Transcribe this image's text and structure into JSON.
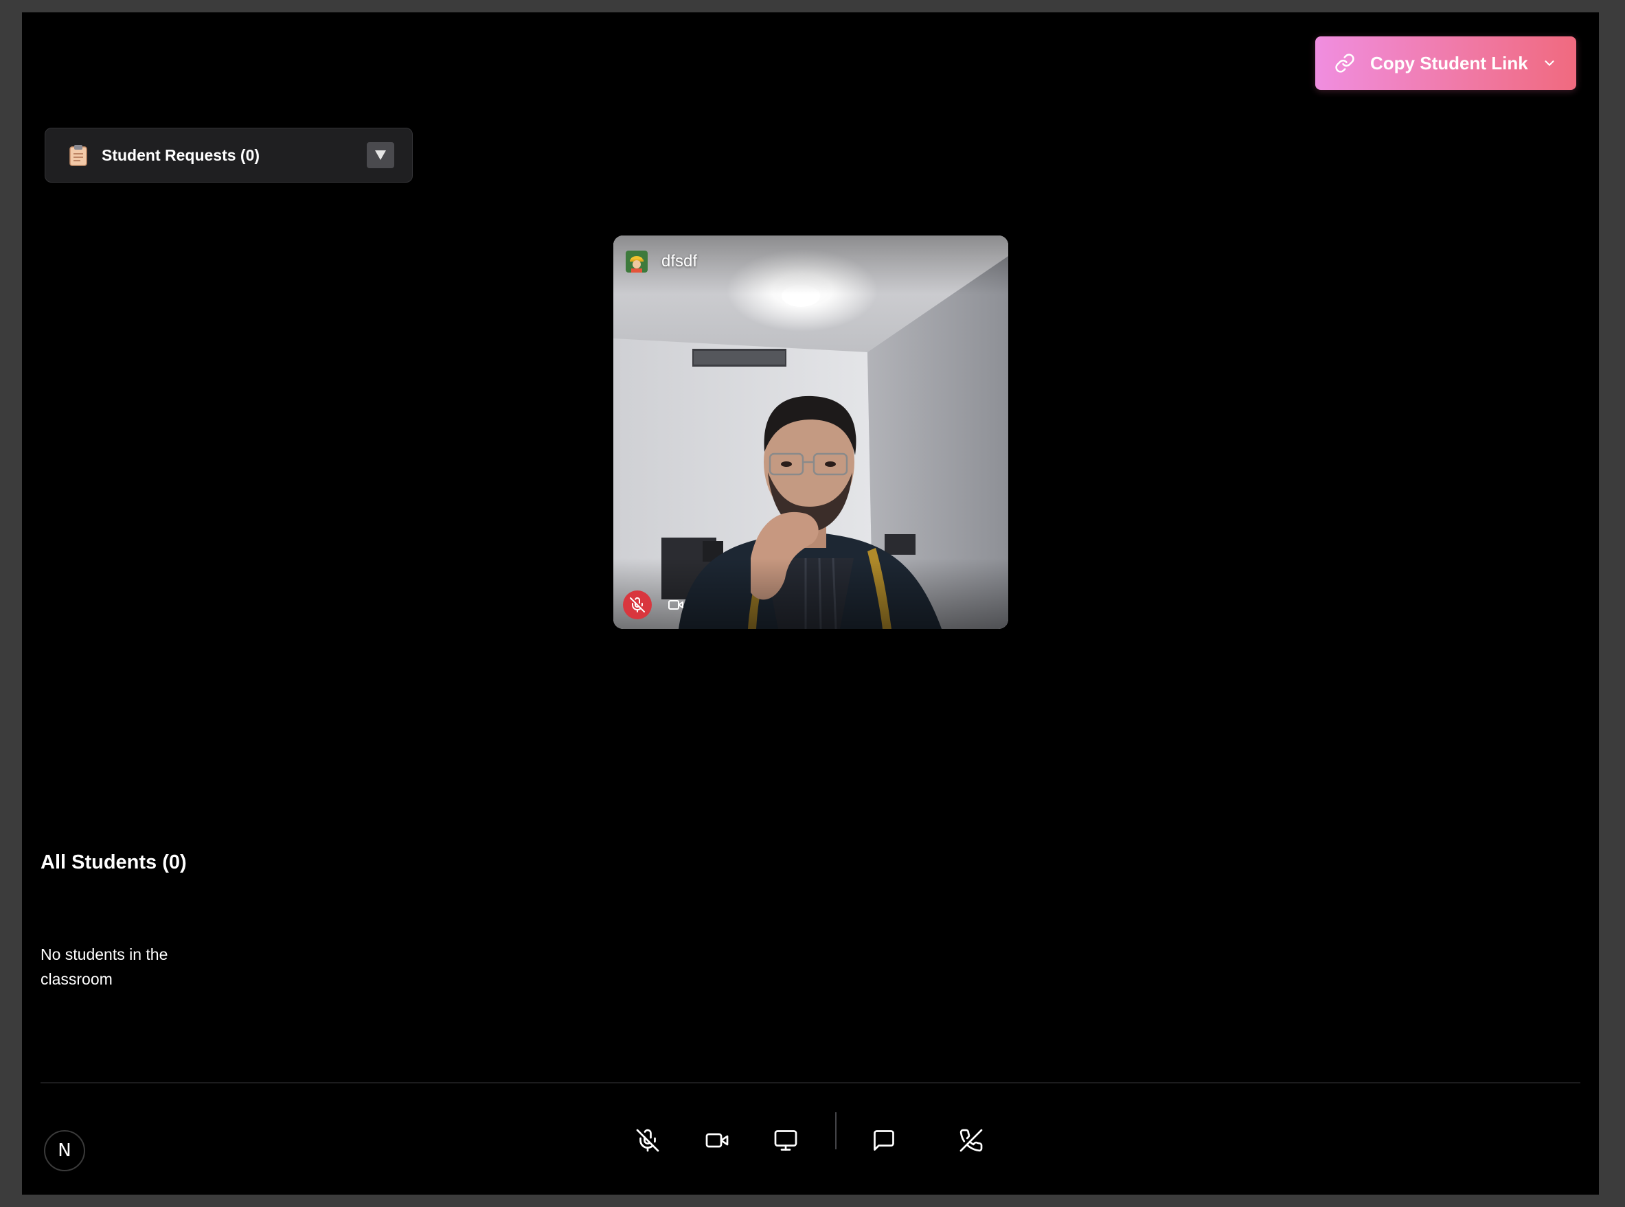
{
  "header": {
    "copy_link_label": "Copy Student Link",
    "copy_link_icon": "link-icon",
    "dropdown_icon": "chevron-down-icon",
    "gradient_colors": [
      "#f08ee0",
      "#f06a7f"
    ]
  },
  "requests": {
    "label": "Student Requests (0)",
    "icon": "clipboard-icon",
    "toggle_icon": "triangle-down-icon"
  },
  "video": {
    "participant_name": "dfsdf",
    "avatar_icon": "construction-worker-emoji",
    "mic_state": "muted",
    "mic_icon": "mic-off-icon",
    "cam_icon": "video-icon",
    "muted_color": "#d9363e"
  },
  "students": {
    "title": "All Students (0)",
    "empty_message": "No students in the classroom"
  },
  "toolbar": {
    "buttons": [
      {
        "name": "mute-mic-button",
        "icon": "mic-off-icon"
      },
      {
        "name": "camera-button",
        "icon": "video-icon"
      },
      {
        "name": "share-screen-button",
        "icon": "monitor-icon"
      },
      {
        "name": "chat-button",
        "icon": "message-icon"
      },
      {
        "name": "end-call-button",
        "icon": "phone-off-icon"
      }
    ]
  },
  "badge": {
    "letter": "N"
  }
}
